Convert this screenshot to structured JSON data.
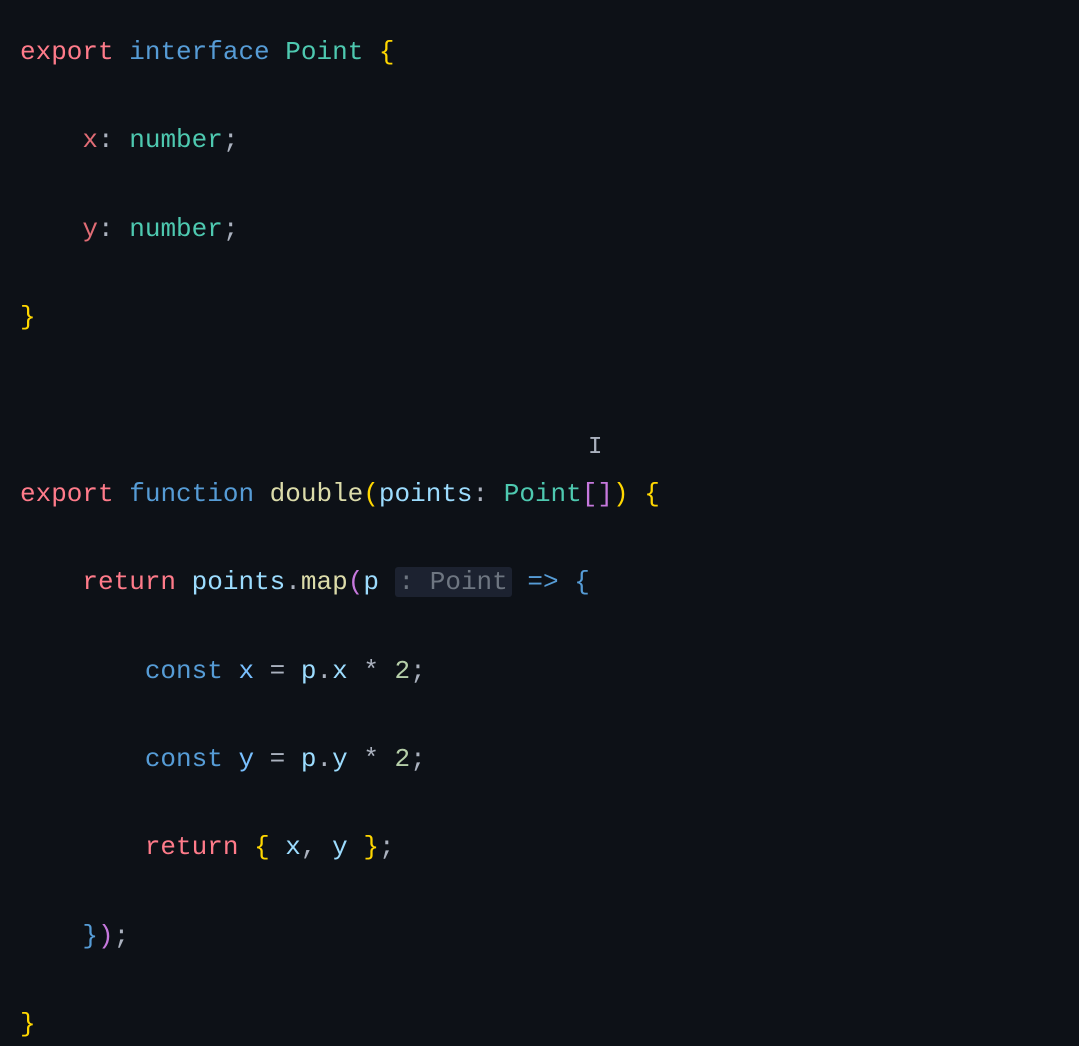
{
  "code": {
    "l1": {
      "export": "export",
      "interface": "interface",
      "name": "Point",
      "open": "{"
    },
    "l2": {
      "prop": "x",
      "colon": ":",
      "type": "number",
      "semi": ";"
    },
    "l3": {
      "prop": "y",
      "colon": ":",
      "type": "number",
      "semi": ";"
    },
    "l4": {
      "close": "}"
    },
    "l6": {
      "export": "export",
      "function": "function",
      "name": "double",
      "lparen": "(",
      "param": "points",
      "colon": ":",
      "type": "Point",
      "lbracket": "[",
      "rbracket": "]",
      "rparen": ")",
      "open": "{"
    },
    "l7": {
      "return": "return",
      "obj": "points",
      "dot": ".",
      "method": "map",
      "lparen": "(",
      "param": "p",
      "inlay": ": Point",
      "arrow": "=>",
      "open": "{"
    },
    "l8": {
      "const": "const",
      "var": "x",
      "eq": "=",
      "obj": "p",
      "dot": ".",
      "prop": "x",
      "mul": "*",
      "num": "2",
      "semi": ";"
    },
    "l9": {
      "const": "const",
      "var": "y",
      "eq": "=",
      "obj": "p",
      "dot": ".",
      "prop": "y",
      "mul": "*",
      "num": "2",
      "semi": ";"
    },
    "l10": {
      "return": "return",
      "open": "{",
      "x": "x",
      "comma": ",",
      "y": "y",
      "close": "}",
      "semi": ";"
    },
    "l11": {
      "close": "}",
      "rparen": ")",
      "semi": ";"
    },
    "l12": {
      "close": "}"
    }
  },
  "cursor": {
    "glyph": "I"
  }
}
